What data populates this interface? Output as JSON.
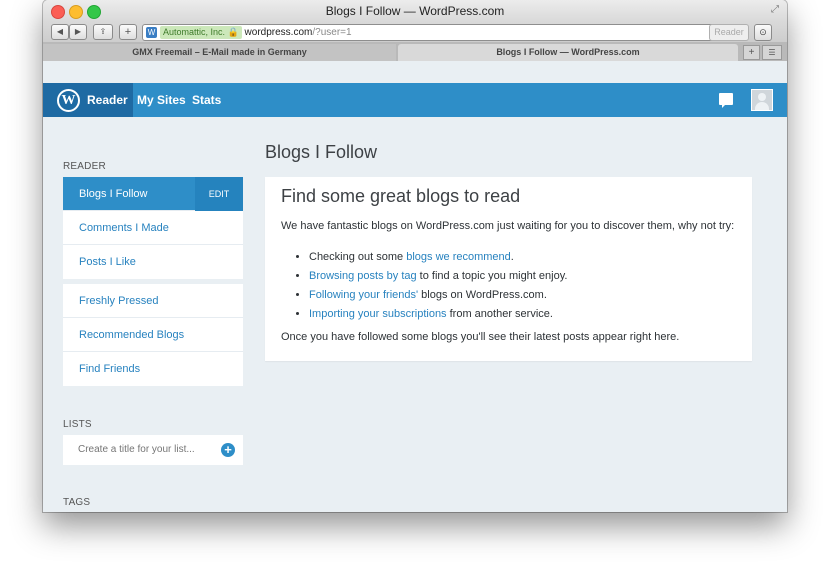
{
  "browser": {
    "window_title": "Blogs I Follow — WordPress.com",
    "address": {
      "org_badge": "Automattic, Inc.",
      "domain": "wordpress.com",
      "path": "/?user=1"
    },
    "reader_button": "Reader",
    "tabs": [
      {
        "label": "GMX Freemail – E-Mail made in Germany",
        "active": false
      },
      {
        "label": "Blogs I Follow — WordPress.com",
        "active": true
      }
    ]
  },
  "masterbar": {
    "items": [
      {
        "label": "Reader",
        "active": true
      },
      {
        "label": "My Sites",
        "active": false
      },
      {
        "label": "Stats",
        "active": false
      }
    ],
    "icons": [
      "wordpress-logo-icon",
      "notifications-icon",
      "avatar"
    ],
    "colors": {
      "bar": "#2e8ec8",
      "active": "#1e6aa3"
    }
  },
  "sidebar": {
    "reader_label": "READER",
    "reader_items": [
      {
        "label": "Blogs I Follow",
        "active": true,
        "action": "EDIT"
      },
      {
        "label": "Comments I Made"
      },
      {
        "label": "Posts I Like"
      }
    ],
    "discover_items": [
      {
        "label": "Freshly Pressed"
      },
      {
        "label": "Recommended Blogs"
      },
      {
        "label": "Find Friends"
      }
    ],
    "lists_label": "LISTS",
    "lists_placeholder": "Create a title for your list...",
    "tags_label": "TAGS"
  },
  "main": {
    "page_title": "Blogs I Follow",
    "card": {
      "heading": "Find some great blogs to read",
      "intro": "We have fantastic blogs on WordPress.com just waiting for you to discover them, why not try:",
      "items": [
        {
          "before": "Checking out some ",
          "link": "blogs we recommend",
          "after": "."
        },
        {
          "before": "",
          "link": "Browsing posts by tag",
          "after": " to find a topic you might enjoy."
        },
        {
          "before": "",
          "link": "Following your friends'",
          "after": " blogs on WordPress.com."
        },
        {
          "before": "",
          "link": "Importing your subscriptions",
          "after": " from another service."
        }
      ],
      "outro": "Once you have followed some blogs you'll see their latest posts appear right here."
    }
  }
}
